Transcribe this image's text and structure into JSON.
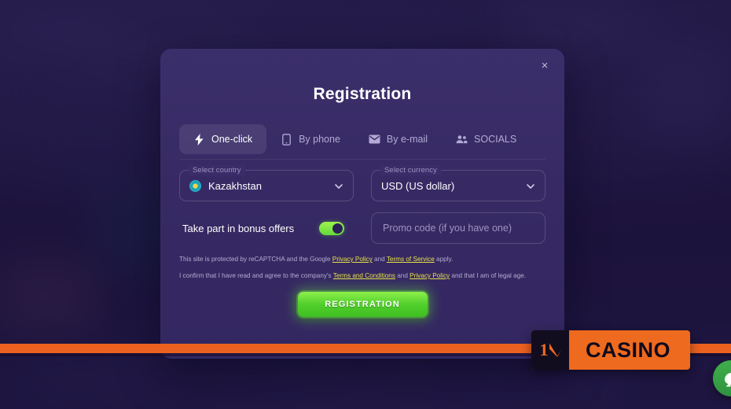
{
  "modal": {
    "title": "Registration",
    "close_label": "×",
    "tabs": [
      {
        "label": "One-click",
        "icon": "lightning-bolt-icon",
        "active": true
      },
      {
        "label": "By phone",
        "icon": "phone-icon",
        "active": false
      },
      {
        "label": "By e-mail",
        "icon": "envelope-icon",
        "active": false
      },
      {
        "label": "SOCIALS",
        "icon": "people-icon",
        "active": false
      }
    ],
    "country_field": {
      "legend": "Select country",
      "value": "Kazakhstan",
      "flag_icon": "kazakhstan-flag-icon",
      "chevron_icon": "chevron-down-icon"
    },
    "currency_field": {
      "legend": "Select currency",
      "value": "USD (US dollar)",
      "chevron_icon": "chevron-down-icon"
    },
    "bonus": {
      "label": "Take part in bonus offers",
      "enabled": true
    },
    "promo": {
      "placeholder": "Promo code (if you have one)",
      "value": ""
    },
    "legal": {
      "line1_a": "This site is protected by reCAPTCHA and the Google ",
      "line1_link1": "Privacy Policy",
      "line1_b": " and ",
      "line1_link2": "Terms of Service",
      "line1_c": " apply.",
      "line2_a": "I confirm that I have read and agree to the company's ",
      "line2_link1": "Terms and Conditions",
      "line2_b": " and ",
      "line2_link2": "Privacy Policy",
      "line2_c": " and that I am of legal age."
    },
    "submit_label": "REGISTRATION"
  },
  "branding": {
    "logo_mark_text": "1",
    "logo_word": "CASINO"
  },
  "support": {
    "icon": "chat-bubble-icon"
  },
  "colors": {
    "accent_green": "#63d93d",
    "brand_orange": "#ee6a1e",
    "link_yellow": "#e7e14a",
    "modal_bg": "#372a64",
    "page_bg": "#241a4a"
  }
}
